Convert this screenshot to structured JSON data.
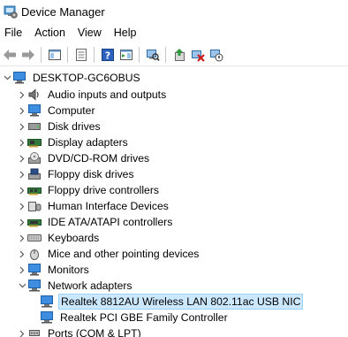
{
  "window": {
    "title": "Device Manager"
  },
  "menu": [
    "File",
    "Action",
    "View",
    "Help"
  ],
  "tree": {
    "root": "DESKTOP-GC6OBUS",
    "categories": [
      {
        "label": "Audio inputs and outputs",
        "icon": "speaker-icon"
      },
      {
        "label": "Computer",
        "icon": "monitor-icon"
      },
      {
        "label": "Disk drives",
        "icon": "disk-drive-icon"
      },
      {
        "label": "Display adapters",
        "icon": "display-adapter-icon"
      },
      {
        "label": "DVD/CD-ROM drives",
        "icon": "dvd-drive-icon"
      },
      {
        "label": "Floppy disk drives",
        "icon": "floppy-drive-icon"
      },
      {
        "label": "Floppy drive controllers",
        "icon": "floppy-controller-icon"
      },
      {
        "label": "Human Interface Devices",
        "icon": "hid-icon"
      },
      {
        "label": "IDE ATA/ATAPI controllers",
        "icon": "ide-controller-icon"
      },
      {
        "label": "Keyboards",
        "icon": "keyboard-icon"
      },
      {
        "label": "Mice and other pointing devices",
        "icon": "mouse-icon"
      },
      {
        "label": "Monitors",
        "icon": "monitor-icon"
      },
      {
        "label": "Network adapters",
        "icon": "network-adapter-icon"
      }
    ],
    "network_children": [
      {
        "label": "Realtek 8812AU Wireless LAN 802.11ac USB NIC",
        "selected": true
      },
      {
        "label": "Realtek PCI GBE Family Controller",
        "selected": false
      }
    ],
    "after": [
      {
        "label": "Ports (COM & LPT)",
        "icon": "port-icon"
      }
    ]
  },
  "colors": {
    "selection_bg": "#cce8ff",
    "selection_border": "#99d1ff"
  }
}
